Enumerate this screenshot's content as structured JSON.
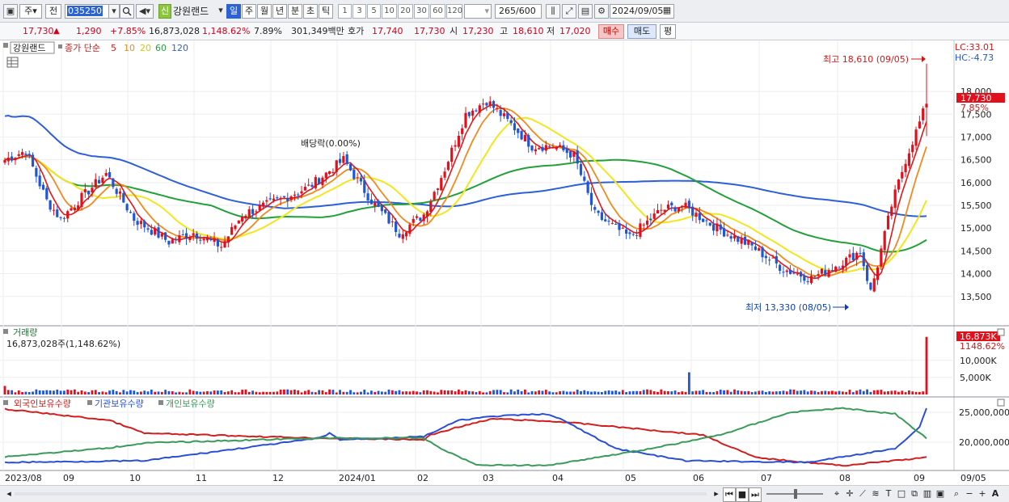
{
  "toolbar": {
    "period_unit": "주",
    "prev_label": "전",
    "code": "035250",
    "badge": "신",
    "stock_name": "강원랜드",
    "timeframes": [
      "일",
      "주",
      "월",
      "년",
      "분",
      "초",
      "틱"
    ],
    "active_timeframe": "일",
    "intervals": [
      "1",
      "3",
      "5",
      "10",
      "20",
      "30",
      "60",
      "120"
    ],
    "count": "265",
    "count_total": "/600",
    "date": "2024/09/05"
  },
  "quote": {
    "price": "17,730",
    "direction_glyph": "▲",
    "change": "1,290",
    "change_pct": "+7.85%",
    "volume": "16,873,028",
    "volume_pct": "1,148.62%",
    "turnover_pct": "7.89%",
    "trade_value": "301,349백만",
    "bid_label": "호가",
    "ask_price": "17,740",
    "bid_price": "17,730",
    "open_label": "시",
    "open": "17,230",
    "high_label": "고",
    "high": "18,610",
    "low_label": "저",
    "low": "17,020",
    "buy_label": "매수",
    "sell_label": "매도",
    "avg_label": "평"
  },
  "price_panel": {
    "stock_label": "강원랜드",
    "ma_title": "종가 단순",
    "ma_periods": [
      "5",
      "10",
      "20",
      "60",
      "120"
    ],
    "lc": "LC:33.01",
    "hc": "HC:-4.73",
    "last_price_tag": "17,730",
    "last_pct_tag": "7.85%",
    "high_annotation": "최고 18,610 (09/05)",
    "low_annotation": "최저 13,330 (08/05)",
    "dividend_annotation": "배당락(0.00%)",
    "y_ticks": [
      "18,000",
      "17,500",
      "17,000",
      "16,500",
      "16,000",
      "15,500",
      "15,000",
      "14,500",
      "14,000",
      "13,500"
    ]
  },
  "volume_panel": {
    "title": "거래량",
    "value_text": "16,873,028주(1,148.62%)",
    "last_tag": "16,873K",
    "last_pct": "1148.62%",
    "y_ticks": [
      "10,000K",
      "5,000K"
    ]
  },
  "holdings_panel": {
    "series": [
      "외국인보유수량",
      "기관보유수량",
      "개인보유수량"
    ],
    "y_ticks": [
      "25,000,000",
      "20,000,000"
    ]
  },
  "x_axis": {
    "labels": [
      "2023/08",
      "09",
      "10",
      "11",
      "12",
      "2024/01",
      "02",
      "03",
      "04",
      "05",
      "06",
      "07",
      "08",
      "09",
      "09/05"
    ]
  },
  "colors": {
    "up": "#e0101c",
    "down": "#1f56d6",
    "ma5": "#e01818",
    "ma10": "#f08a1c",
    "ma20": "#f2e61c",
    "ma60": "#22a03a",
    "ma120": "#2d5fd6",
    "foreign": "#d21e1e",
    "institution": "#2a4fd4",
    "individual": "#3a9a5a"
  },
  "chart_data": {
    "type": "candlestick",
    "ohlc_approx_close_by_month": [
      {
        "month": "2023/08",
        "close_range": [
          15500,
          16800
        ]
      },
      {
        "month": "2023/09",
        "close_range": [
          15300,
          16000
        ]
      },
      {
        "month": "2023/10",
        "close_range": [
          14500,
          15200
        ]
      },
      {
        "month": "2023/11",
        "close_range": [
          14700,
          15600
        ]
      },
      {
        "month": "2023/12",
        "close_range": [
          15700,
          16600
        ]
      },
      {
        "month": "2024/01",
        "close_range": [
          14700,
          15700
        ]
      },
      {
        "month": "2024/02",
        "close_range": [
          15500,
          18200
        ]
      },
      {
        "month": "2024/03",
        "close_range": [
          16700,
          17300
        ]
      },
      {
        "month": "2024/04",
        "close_range": [
          14800,
          16600
        ]
      },
      {
        "month": "2024/05",
        "close_range": [
          15000,
          15700
        ]
      },
      {
        "month": "2024/06",
        "close_range": [
          14300,
          15100
        ]
      },
      {
        "month": "2024/07",
        "close_range": [
          13800,
          14500
        ]
      },
      {
        "month": "2024/08",
        "close_range": [
          13330,
          16500
        ]
      },
      {
        "month": "2024/09",
        "close_range": [
          16500,
          17730
        ]
      }
    ],
    "ylim": [
      13000,
      18800
    ]
  }
}
